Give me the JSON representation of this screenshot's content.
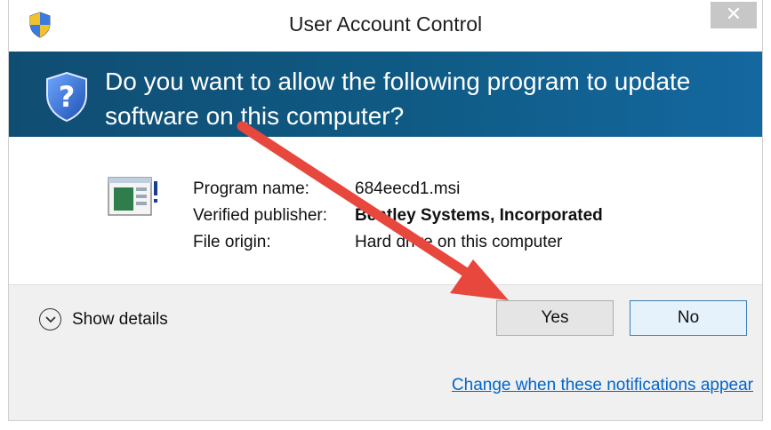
{
  "window": {
    "title": "User Account Control",
    "close_glyph": "✕"
  },
  "banner": {
    "question": "Do you want to allow the following program to update software on this computer?"
  },
  "details": {
    "rows": [
      {
        "label": "Program name:",
        "value": "684eecd1.msi"
      },
      {
        "label": "Verified publisher:",
        "value": "Bentley Systems, Incorporated"
      },
      {
        "label": "File origin:",
        "value": "Hard drive on this computer"
      }
    ]
  },
  "actions": {
    "show_details": "Show details",
    "yes": "Yes",
    "no": "No"
  },
  "footer": {
    "link": "Change when these notifications appear"
  },
  "icons": {
    "title": "uac-shield-icon",
    "banner": "question-shield-icon",
    "program": "program-installer-icon",
    "details": "chevron-down-circle-icon"
  },
  "colors": {
    "banner": "#0f5b85",
    "link": "#0066cc",
    "annotation_arrow": "#e8473d"
  }
}
